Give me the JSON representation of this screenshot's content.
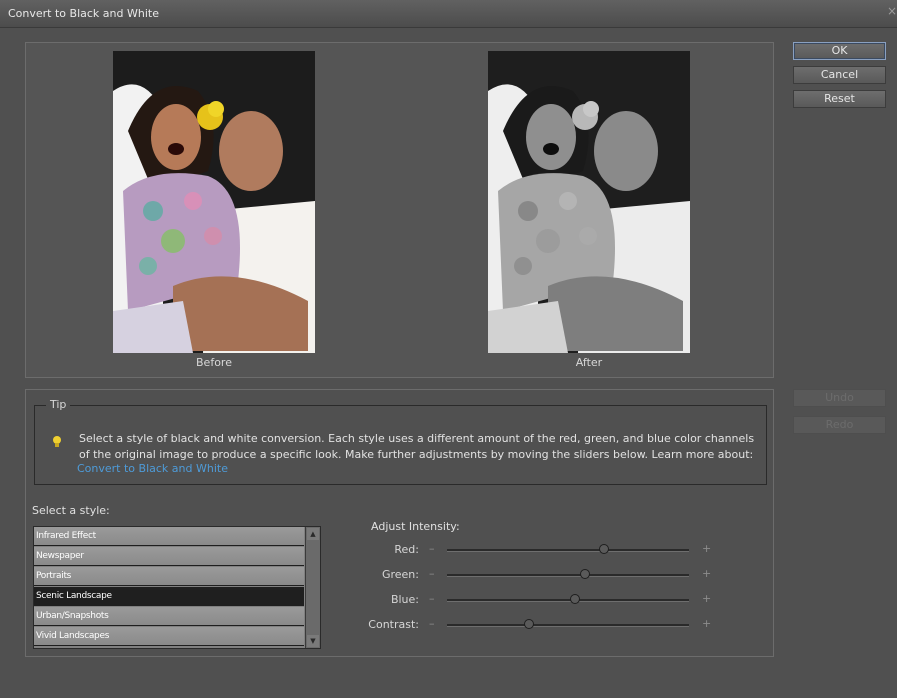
{
  "window": {
    "title": "Convert to Black and White",
    "close_glyph": "×"
  },
  "preview": {
    "before_label": "Before",
    "after_label": "After"
  },
  "buttons": {
    "ok": "OK",
    "cancel": "Cancel",
    "reset": "Reset",
    "undo": "Undo",
    "redo": "Redo"
  },
  "tip": {
    "legend": "Tip",
    "icon": "lightbulb-icon",
    "text": "Select a style of black and white conversion. Each style uses a different amount of the red, green, and blue color channels of the original image to produce a specific look. Make further adjustments by moving the sliders below. Learn more about:",
    "link": "Convert to Black and White"
  },
  "styles": {
    "label": "Select a style:",
    "items": [
      "Infrared Effect",
      "Newspaper",
      "Portraits",
      "Scenic Landscape",
      "Urban/Snapshots",
      "Vivid Landscapes"
    ],
    "selected": "Scenic Landscape"
  },
  "adjust": {
    "label": "Adjust Intensity:",
    "minus": "–",
    "plus": "+",
    "sliders": [
      {
        "label": "Red:",
        "value": 0.65
      },
      {
        "label": "Green:",
        "value": 0.57
      },
      {
        "label": "Blue:",
        "value": 0.53
      },
      {
        "label": "Contrast:",
        "value": 0.34
      }
    ]
  },
  "colors": {
    "accent_link": "#4e9bd8",
    "default_button_border": "#8aa0c0",
    "tip_bulb": "#f0d030"
  }
}
